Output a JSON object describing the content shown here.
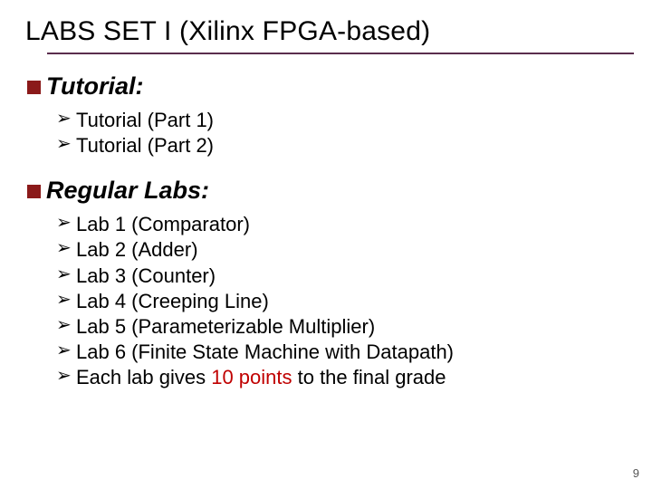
{
  "title": "LABS SET I (Xilinx FPGA-based)",
  "sections": [
    {
      "heading": "Tutorial:",
      "items": [
        "Tutorial (Part 1)",
        "Tutorial (Part 2)"
      ]
    },
    {
      "heading": "Regular Labs:",
      "items": [
        "Lab 1 (Comparator)",
        "Lab 2 (Adder)",
        "Lab 3 (Counter)",
        "Lab 4 (Creeping Line)",
        "Lab 5 (Parameterizable Multiplier)",
        "Lab 6 (Finite State Machine with Datapath)"
      ],
      "note": {
        "before": "Each lab gives ",
        "highlight": "10 points",
        "after": " to the final grade"
      }
    }
  ],
  "page_number": "9",
  "glyphs": {
    "arrow": "➢"
  }
}
